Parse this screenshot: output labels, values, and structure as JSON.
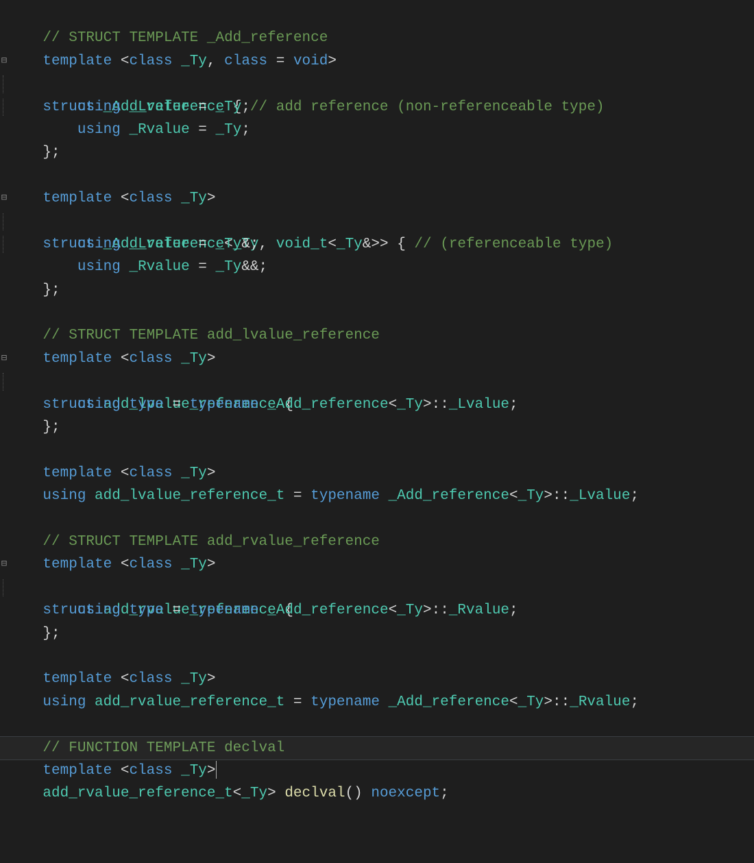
{
  "code": {
    "l1": {
      "c1": "// STRUCT TEMPLATE _Add_reference"
    },
    "l2": {
      "kw1": "template",
      "a1": " <",
      "kw2": "class",
      "sp1": " ",
      "typ1": "_Ty",
      "p1": ", ",
      "kw3": "class",
      "p2": " = ",
      "kw4": "void",
      "a2": ">"
    },
    "l3": {
      "kw1": "struct",
      "sp1": " ",
      "typ1": "_Add_reference",
      "p1": " { ",
      "c1": "// add reference (non-referenceable type)"
    },
    "l4": {
      "ind": "    ",
      "kw1": "using",
      "sp1": " ",
      "typ1": "_Lvalue",
      "p1": " = ",
      "typ2": "_Ty",
      "p2": ";"
    },
    "l5": {
      "ind": "    ",
      "kw1": "using",
      "sp1": " ",
      "typ1": "_Rvalue",
      "p1": " = ",
      "typ2": "_Ty",
      "p2": ";"
    },
    "l6": {
      "p1": "};"
    },
    "l7": {
      "blank": " "
    },
    "l8": {
      "kw1": "template",
      "a1": " <",
      "kw2": "class",
      "sp1": " ",
      "typ1": "_Ty",
      "a2": ">"
    },
    "l9": {
      "kw1": "struct",
      "sp1": " ",
      "typ1": "_Add_reference",
      "a1": "<",
      "typ2": "_Ty",
      "p1": ", ",
      "typ3": "void_t",
      "a2": "<",
      "typ4": "_Ty",
      "amp": "&",
      "a3": ">>",
      "p2": " { ",
      "c1": "// (referenceable type)"
    },
    "l10": {
      "ind": "    ",
      "kw1": "using",
      "sp1": " ",
      "typ1": "_Lvalue",
      "p1": " = ",
      "typ2": "_Ty",
      "amp": "&",
      "p2": ";"
    },
    "l11": {
      "ind": "    ",
      "kw1": "using",
      "sp1": " ",
      "typ1": "_Rvalue",
      "p1": " = ",
      "typ2": "_Ty",
      "amp": "&&",
      "p2": ";"
    },
    "l12": {
      "p1": "};"
    },
    "l13": {
      "blank": " "
    },
    "l14": {
      "c1": "// STRUCT TEMPLATE add_lvalue_reference"
    },
    "l15": {
      "kw1": "template",
      "a1": " <",
      "kw2": "class",
      "sp1": " ",
      "typ1": "_Ty",
      "a2": ">"
    },
    "l16": {
      "kw1": "struct",
      "sp1": " ",
      "typ1": "add_lvalue_reference",
      "p1": " {"
    },
    "l17": {
      "ind": "    ",
      "kw1": "using",
      "sp1": " ",
      "kw2": "type",
      "p1": " = ",
      "kw3": "typename",
      "sp2": " ",
      "typ1": "_Add_reference",
      "a1": "<",
      "typ2": "_Ty",
      "a2": ">::",
      "typ3": "_Lvalue",
      "p2": ";"
    },
    "l18": {
      "p1": "};"
    },
    "l19": {
      "blank": " "
    },
    "l20": {
      "kw1": "template",
      "a1": " <",
      "kw2": "class",
      "sp1": " ",
      "typ1": "_Ty",
      "a2": ">"
    },
    "l21": {
      "kw1": "using",
      "sp1": " ",
      "typ1": "add_lvalue_reference_t",
      "p1": " = ",
      "kw2": "typename",
      "sp2": " ",
      "typ2": "_Add_reference",
      "a1": "<",
      "typ3": "_Ty",
      "a2": ">::",
      "typ4": "_Lvalue",
      "p2": ";"
    },
    "l22": {
      "blank": " "
    },
    "l23": {
      "c1": "// STRUCT TEMPLATE add_rvalue_reference"
    },
    "l24": {
      "kw1": "template",
      "a1": " <",
      "kw2": "class",
      "sp1": " ",
      "typ1": "_Ty",
      "a2": ">"
    },
    "l25": {
      "kw1": "struct",
      "sp1": " ",
      "typ1": "add_rvalue_reference",
      "p1": " {"
    },
    "l26": {
      "ind": "    ",
      "kw1": "using",
      "sp1": " ",
      "kw2": "type",
      "p1": " = ",
      "kw3": "typename",
      "sp2": " ",
      "typ1": "_Add_reference",
      "a1": "<",
      "typ2": "_Ty",
      "a2": ">::",
      "typ3": "_Rvalue",
      "p2": ";"
    },
    "l27": {
      "p1": "};"
    },
    "l28": {
      "blank": " "
    },
    "l29": {
      "kw1": "template",
      "a1": " <",
      "kw2": "class",
      "sp1": " ",
      "typ1": "_Ty",
      "a2": ">"
    },
    "l30": {
      "kw1": "using",
      "sp1": " ",
      "typ1": "add_rvalue_reference_t",
      "p1": " = ",
      "kw2": "typename",
      "sp2": " ",
      "typ2": "_Add_reference",
      "a1": "<",
      "typ3": "_Ty",
      "a2": ">::",
      "typ4": "_Rvalue",
      "p2": ";"
    },
    "l31": {
      "blank": " "
    },
    "l32": {
      "c1": "// FUNCTION TEMPLATE declval"
    },
    "l33": {
      "kw1": "template",
      "a1": " <",
      "kw2": "class",
      "sp1": " ",
      "typ1": "_Ty",
      "a2": ">"
    },
    "l34": {
      "typ1": "add_rvalue_reference_t",
      "a1": "<",
      "typ2": "_Ty",
      "a2": "> ",
      "fn1": "declval",
      "p1": "() ",
      "kw1": "noexcept",
      "p2": ";"
    }
  },
  "gutter": {
    "collapse": "⊟"
  }
}
